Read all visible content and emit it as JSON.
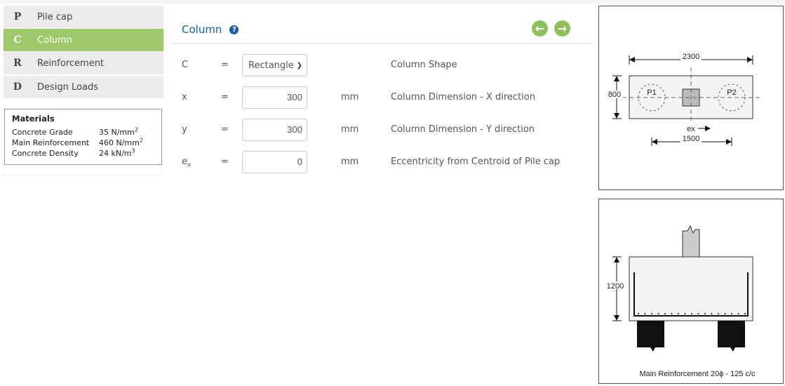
{
  "sidebar": {
    "items": [
      {
        "letter": "P",
        "label": "Pile cap",
        "active": false
      },
      {
        "letter": "C",
        "label": "Column",
        "active": true
      },
      {
        "letter": "R",
        "label": "Reinforcement",
        "active": false
      },
      {
        "letter": "D",
        "label": "Design Loads",
        "active": false
      }
    ]
  },
  "materials": {
    "title": "Materials",
    "rows": [
      {
        "label": "Concrete Grade",
        "value": "35 N/mm",
        "sup": "2"
      },
      {
        "label": "Main Reinforcement",
        "value": "460 N/mm",
        "sup": "2"
      },
      {
        "label": "Concrete Density",
        "value": "24 kN/m",
        "sup": "3"
      }
    ]
  },
  "main": {
    "title": "Column",
    "help_icon": "?",
    "prev_icon": "arrow-left-circle",
    "next_icon": "arrow-right-circle",
    "rows": [
      {
        "symbol": "C",
        "eq": "=",
        "value": "Rectangle",
        "unit": "",
        "desc": "Column Shape"
      },
      {
        "symbol": "x",
        "eq": "=",
        "value": "300",
        "unit": "mm",
        "desc": "Column Dimension - X direction"
      },
      {
        "symbol": "y",
        "eq": "=",
        "value": "300",
        "unit": "mm",
        "desc": "Column Dimension - Y direction"
      },
      {
        "symbol": "e",
        "sub": "x",
        "eq": "=",
        "value": "0",
        "unit": "mm",
        "desc": "Eccentricity from Centroid of Pile cap"
      }
    ]
  },
  "plan": {
    "width": "2300",
    "depth": "800",
    "pile_spacing": "1500",
    "p1": "P1",
    "p2": "P2",
    "ex": "ex"
  },
  "section": {
    "height": "1200",
    "caption": "Main Reinforcement 20ϕ - 125 c/c"
  },
  "colors": {
    "accent": "#9dc96a",
    "title": "#1d5aa0"
  }
}
